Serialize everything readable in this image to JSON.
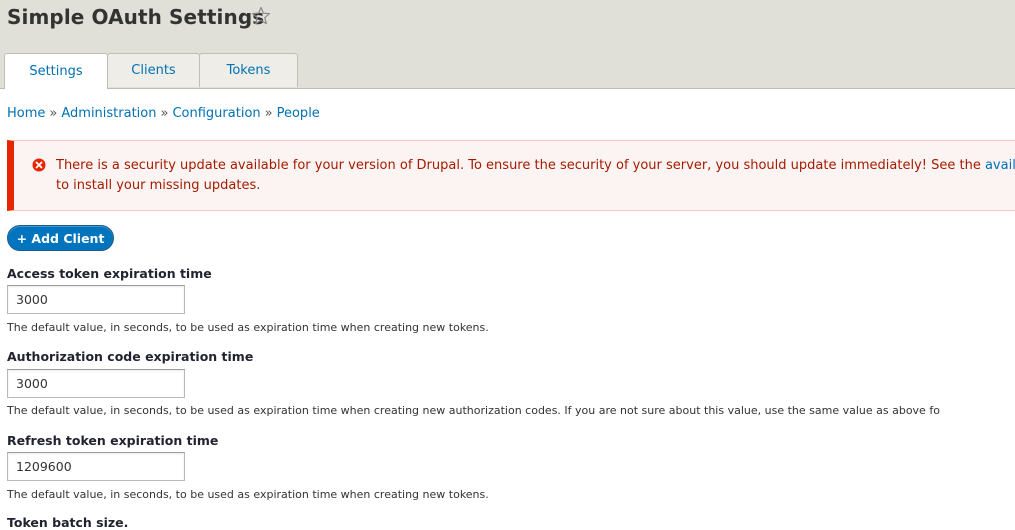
{
  "header": {
    "title": "Simple OAuth Settings",
    "star_icon": "star-outline-icon"
  },
  "tabs": [
    {
      "label": "Settings",
      "active": true
    },
    {
      "label": "Clients",
      "active": false
    },
    {
      "label": "Tokens",
      "active": false
    }
  ],
  "breadcrumb": {
    "items": [
      "Home",
      "Administration",
      "Configuration",
      "People"
    ],
    "separator": "»"
  },
  "message": {
    "type": "error",
    "icon": "error-circle-icon",
    "line1_text": "There is a security update available for your version of Drupal. To ensure the security of your server, you should update immediately! See the ",
    "line1_link": "available up",
    "line2_text": "to install your missing updates."
  },
  "add_button": {
    "label": "+ Add Client"
  },
  "fields": [
    {
      "label": "Access token expiration time",
      "value": "3000",
      "description": "The default value, in seconds, to be used as expiration time when creating new tokens."
    },
    {
      "label": "Authorization code expiration time",
      "value": "3000",
      "description": "The default value, in seconds, to be used as expiration time when creating new authorization codes. If you are not sure about this value, use the same value as above fo"
    },
    {
      "label": "Refresh token expiration time",
      "value": "1209600",
      "description": "The default value, in seconds, to be used as expiration time when creating new tokens."
    },
    {
      "label": "Token batch size."
    }
  ],
  "colors": {
    "link": "#0071b3",
    "header_bg": "#e0dfd8",
    "error_border": "#e62600",
    "error_bg": "#fcf4f2",
    "error_text": "#a51b00",
    "button_bg": "#0074bd"
  }
}
